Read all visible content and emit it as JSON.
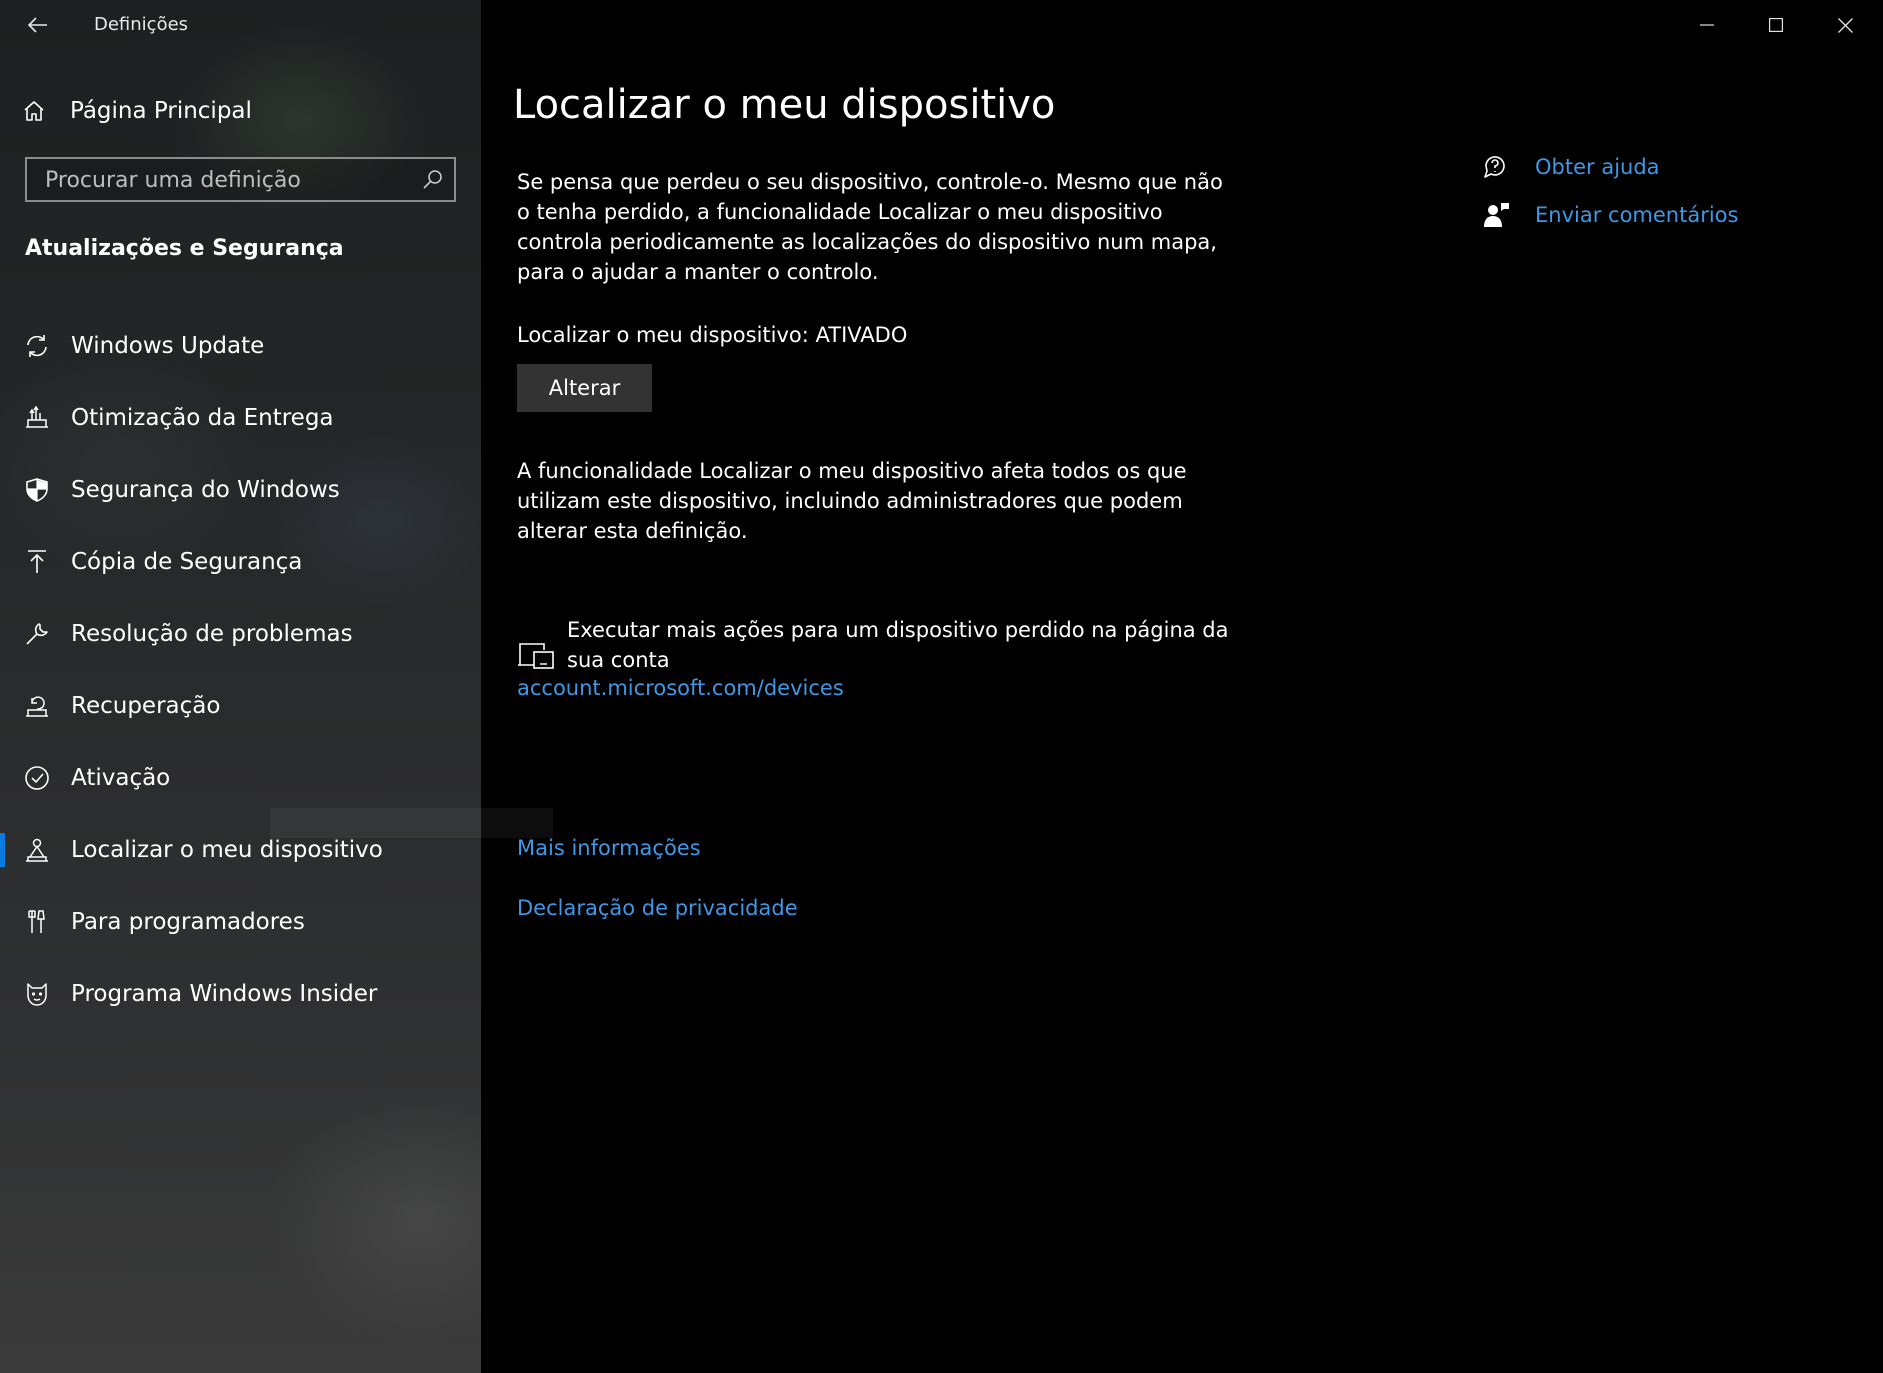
{
  "window": {
    "title": "Definições",
    "controls": {
      "minimize": "minimize-icon",
      "maximize": "maximize-icon",
      "close": "close-icon"
    }
  },
  "sidebar": {
    "home_label": "Página Principal",
    "search_placeholder": "Procurar uma definição",
    "section_title": "Atualizações e Segurança",
    "items": [
      {
        "label": "Windows Update",
        "icon": "sync-icon"
      },
      {
        "label": "Otimização da Entrega",
        "icon": "delivery-optimization-icon"
      },
      {
        "label": "Segurança do Windows",
        "icon": "shield-icon"
      },
      {
        "label": "Cópia de Segurança",
        "icon": "backup-arrow-icon"
      },
      {
        "label": "Resolução de problemas",
        "icon": "wrench-icon"
      },
      {
        "label": "Recuperação",
        "icon": "recovery-icon"
      },
      {
        "label": "Ativação",
        "icon": "check-circle-icon"
      },
      {
        "label": "Localizar o meu dispositivo",
        "icon": "find-device-icon",
        "selected": true
      },
      {
        "label": "Para programadores",
        "icon": "developer-tools-icon"
      },
      {
        "label": "Programa Windows Insider",
        "icon": "insider-cat-icon"
      }
    ],
    "accent_color": "#0a7ce0"
  },
  "main": {
    "title": "Localizar o meu dispositivo",
    "intro": "Se pensa que perdeu o seu dispositivo, controle-o. Mesmo que não o tenha perdido, a funcionalidade Localizar o meu dispositivo controla periodicamente as localizações do dispositivo num mapa, para o ajudar a manter o controlo.",
    "status": "Localizar o meu dispositivo: ATIVADO",
    "change_button": "Alterar",
    "affects_text": "A funcionalidade Localizar o meu dispositivo afeta todos os que utilizam este dispositivo, incluindo administradores que podem alterar esta definição.",
    "account_text": "Executar mais ações para um dispositivo perdido na página da sua conta",
    "account_link": "account.microsoft.com/devices",
    "more_info_link": "Mais informações",
    "privacy_link": "Declaração de privacidade",
    "link_color": "#3f97e6"
  },
  "help": {
    "get_help": "Obter ajuda",
    "feedback": "Enviar comentários"
  }
}
